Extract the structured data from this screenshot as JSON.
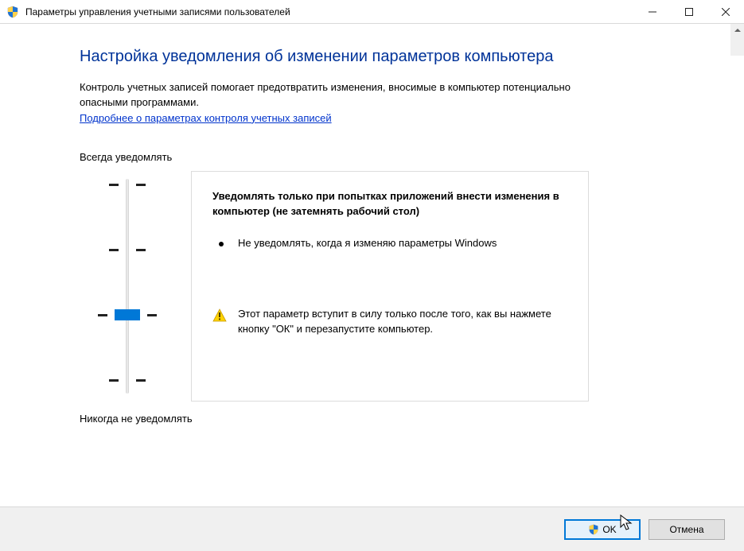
{
  "window": {
    "title": "Параметры управления учетными записями пользователей"
  },
  "main": {
    "heading": "Настройка уведомления об изменении параметров компьютера",
    "description": "Контроль учетных записей помогает предотвратить изменения, вносимые в компьютер потенциально опасными программами.",
    "link": "Подробнее о параметрах контроля учетных записей",
    "label_top": "Всегда уведомлять",
    "label_bottom": "Никогда не уведомлять"
  },
  "panel": {
    "title": "Уведомлять только при попытках приложений внести изменения в компьютер (не затемнять рабочий стол)",
    "bullet": "Не уведомлять, когда я изменяю параметры Windows",
    "warning": "Этот параметр вступит в силу только после того, как вы нажмете кнопку \"ОК\" и перезапустите компьютер."
  },
  "footer": {
    "ok": "OK",
    "cancel": "Отмена"
  }
}
